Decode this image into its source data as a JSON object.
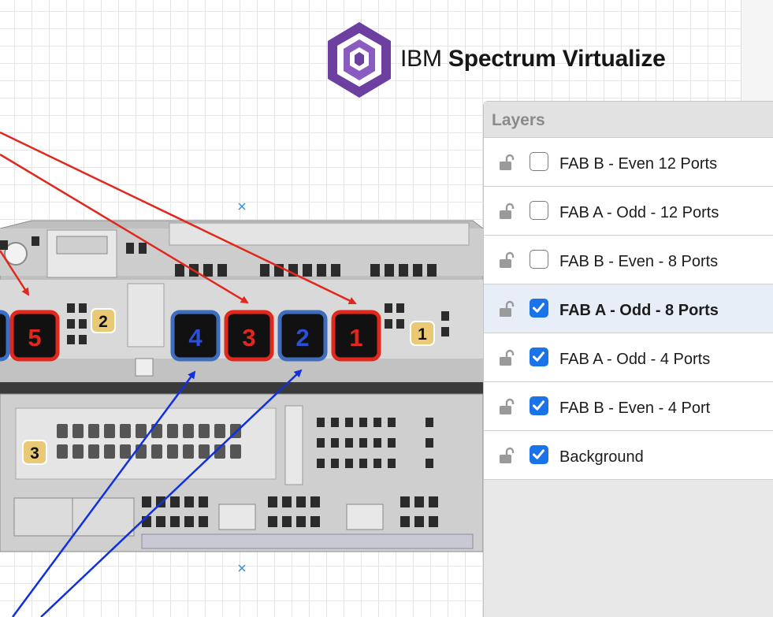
{
  "logo": {
    "brand": "IBM",
    "product": "Spectrum Virtualize"
  },
  "hardware": {
    "port_numbers": [
      "5",
      "4",
      "3",
      "2",
      "1"
    ],
    "slot_badges": [
      "2",
      "1",
      "3"
    ]
  },
  "layers_panel": {
    "title": "Layers",
    "items": [
      {
        "label": "FAB B - Even 12 Ports",
        "visible": false,
        "selected": false
      },
      {
        "label": "FAB A - Odd - 12 Ports",
        "visible": false,
        "selected": false
      },
      {
        "label": "FAB B - Even - 8 Ports",
        "visible": false,
        "selected": false
      },
      {
        "label": "FAB A - Odd - 8 Ports",
        "visible": true,
        "selected": true
      },
      {
        "label": "FAB A - Odd - 4 Ports",
        "visible": true,
        "selected": false
      },
      {
        "label": "FAB B - Even - 4 Port",
        "visible": true,
        "selected": false
      },
      {
        "label": "Background",
        "visible": true,
        "selected": false
      }
    ]
  },
  "colors": {
    "accent": "#1a73e8",
    "odd_port_red": "#e0281e",
    "even_port_blue": "#2b4fd6",
    "logo_purple": "#6d3fa0",
    "badge_gold": "#e9c974"
  }
}
